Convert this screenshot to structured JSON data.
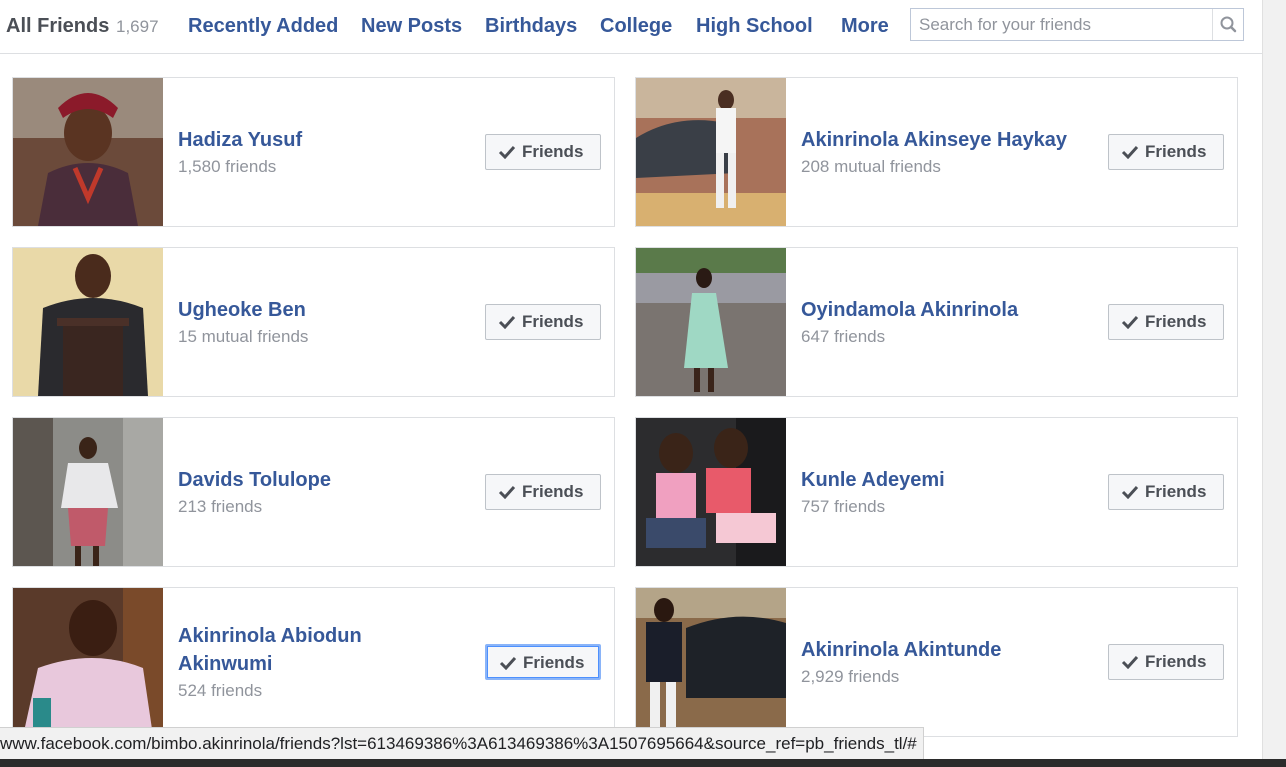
{
  "tabs": [
    {
      "label": "All Friends",
      "count": "1,697"
    },
    {
      "label": "Recently Added"
    },
    {
      "label": "New Posts"
    },
    {
      "label": "Birthdays"
    },
    {
      "label": "College"
    },
    {
      "label": "High School"
    },
    {
      "label": "More"
    }
  ],
  "search": {
    "placeholder": "Search for your friends",
    "icon": "search-icon"
  },
  "friends": [
    {
      "name": "Hadiza Yusuf",
      "sub": "1,580 friends",
      "button": "Friends"
    },
    {
      "name": "Akinrinola Akinseye Haykay",
      "sub": "208 mutual friends",
      "button": "Friends"
    },
    {
      "name": "Ugheoke Ben",
      "sub": "15 mutual friends",
      "button": "Friends"
    },
    {
      "name": "Oyindamola Akinrinola",
      "sub": "647 friends",
      "button": "Friends"
    },
    {
      "name": "Davids Tolulope",
      "sub": "213 friends",
      "button": "Friends"
    },
    {
      "name": "Kunle Adeyemi",
      "sub": "757 friends",
      "button": "Friends"
    },
    {
      "name_line1": "Akinrinola Abiodun",
      "name_line2": "Akinwumi",
      "sub": "524 friends",
      "button": "Friends"
    },
    {
      "name": "Akinrinola Akintunde",
      "sub": "2,929 friends",
      "button": "Friends"
    }
  ],
  "status_url": "www.facebook.com/bimbo.akinrinola/friends?lst=613469386%3A613469386%3A1507695664&source_ref=pb_friends_tl/#",
  "colors": {
    "link": "#365899",
    "muted": "#90949c",
    "border": "#dddfe2"
  }
}
